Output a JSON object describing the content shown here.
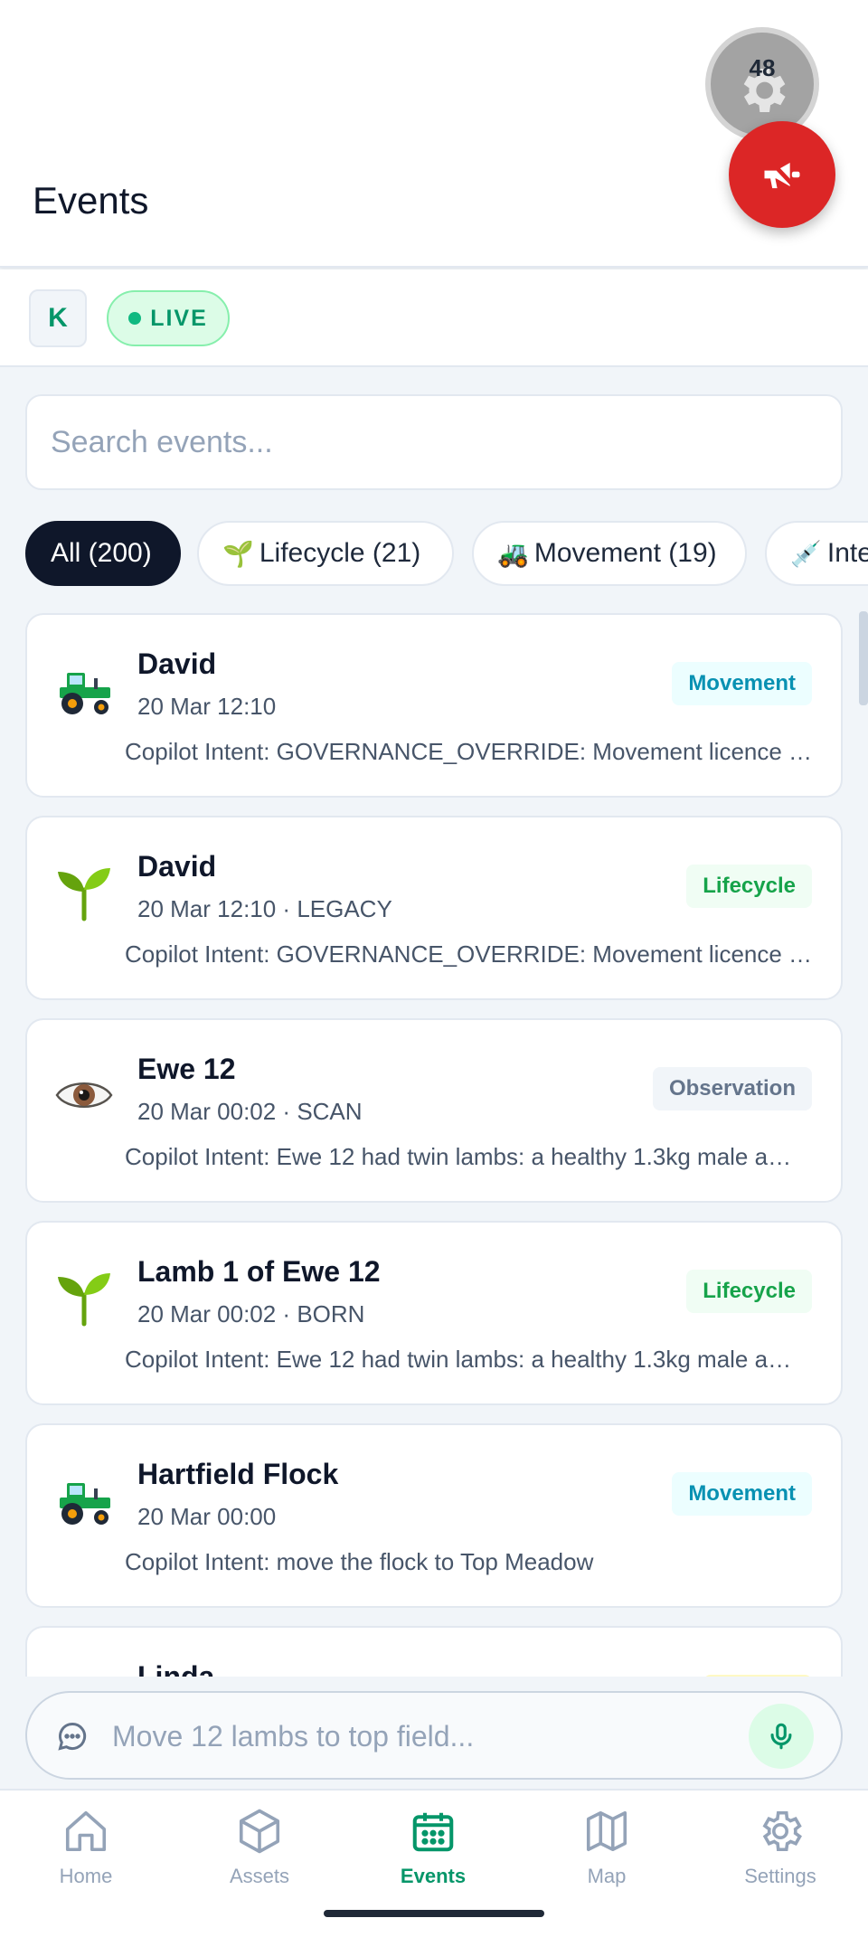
{
  "header": {
    "title": "Events",
    "gear_badge_count": "48",
    "gear_icon": "gear-icon",
    "alert_icon": "megaphone-off-icon",
    "alert_color": "#dc2626"
  },
  "status": {
    "user_initial": "K",
    "live_label": "LIVE"
  },
  "search": {
    "placeholder": "Search events..."
  },
  "filters": [
    {
      "icon": "🌱",
      "label": "All (200)",
      "active": true
    },
    {
      "icon": "🌱",
      "label": "Lifecycle (21)"
    },
    {
      "icon": "🚜",
      "label": "Movement (19)"
    },
    {
      "icon": "💉",
      "label": "Inte"
    }
  ],
  "events": [
    {
      "icon": "tractor-icon",
      "title": "David",
      "meta": "20 Mar 12:10",
      "tag": "Movement",
      "description": "Copilot Intent: GOVERNANCE_OVERRIDE: Movement licence a…"
    },
    {
      "icon": "seedling-icon",
      "title": "David",
      "meta": "20 Mar 12:10 · LEGACY",
      "tag": "Lifecycle",
      "description": "Copilot Intent: GOVERNANCE_OVERRIDE: Movement licence a…"
    },
    {
      "icon": "eye-icon",
      "title": "Ewe 12",
      "meta": "20 Mar 00:02 · SCAN",
      "tag": "Observation",
      "description": "Copilot Intent: Ewe 12 had twin lambs: a healthy 1.3kg male a…"
    },
    {
      "icon": "seedling-icon",
      "title": "Lamb 1 of Ewe 12",
      "meta": "20 Mar 00:02 · BORN",
      "tag": "Lifecycle",
      "description": "Copilot Intent: Ewe 12 had twin lambs: a healthy 1.3kg male a…"
    },
    {
      "icon": "tractor-icon",
      "title": "Hartfield Flock",
      "meta": "20 Mar 00:00",
      "tag": "Movement",
      "description": "Copilot Intent: move the flock to Top Meadow"
    },
    {
      "icon": "check-icon",
      "title": "Linda",
      "meta": "",
      "tag": "",
      "description": ""
    }
  ],
  "tag_colors": {
    "Movement": {
      "bg": "#ecfeff",
      "fg": "#0891b2"
    },
    "Lifecycle": {
      "bg": "#f0fdf4",
      "fg": "#16a34a"
    },
    "Observation": {
      "bg": "#f1f5f9",
      "fg": "#64748b"
    }
  },
  "composer": {
    "placeholder": "Move 12 lambs to top field...",
    "chat_icon": "chat-bubble-icon",
    "mic_icon": "microphone-icon"
  },
  "nav": [
    {
      "label": "Home",
      "icon": "home-icon"
    },
    {
      "label": "Assets",
      "icon": "cube-icon"
    },
    {
      "label": "Events",
      "icon": "calendar-icon",
      "active": true
    },
    {
      "label": "Map",
      "icon": "map-icon"
    },
    {
      "label": "Settings",
      "icon": "gear-icon"
    }
  ],
  "accent": "#059669"
}
